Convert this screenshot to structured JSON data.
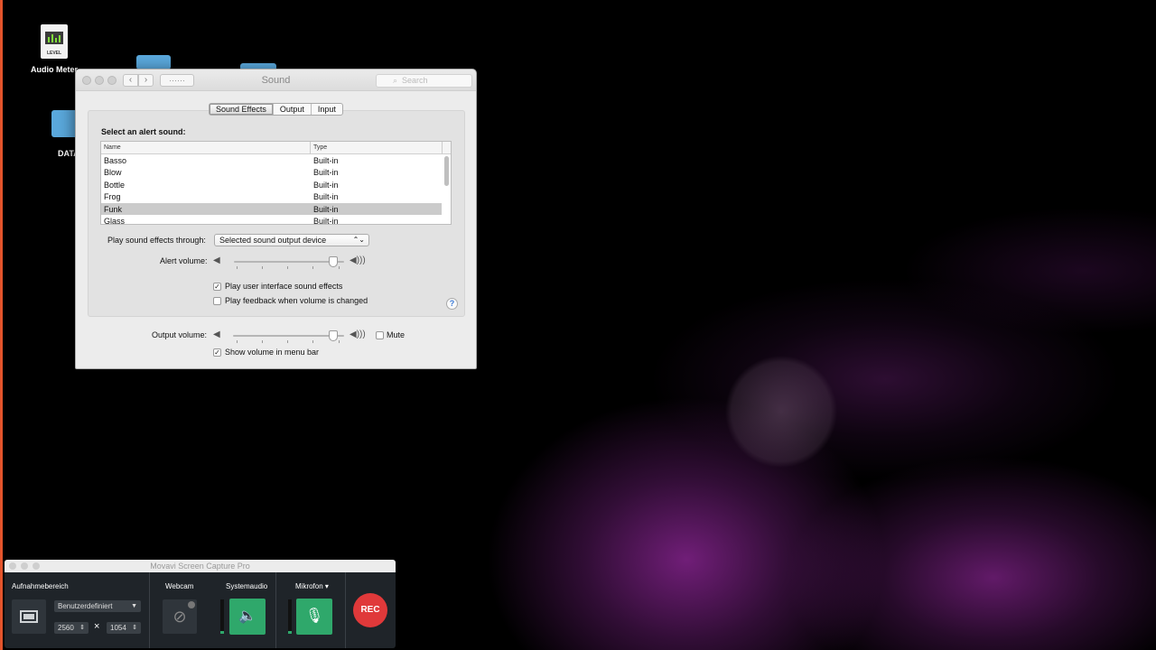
{
  "desktop": {
    "icons": [
      {
        "label": "Audio Meter"
      },
      {
        "label": "DATA"
      }
    ],
    "audio_meter_doc_text": "LEVEL"
  },
  "sound_window": {
    "title": "Sound",
    "search_placeholder": "Search",
    "nav_back_glyph": "‹",
    "nav_forward_glyph": "›",
    "grid_glyph": "⋯⋯",
    "tabs": [
      {
        "label": "Sound Effects",
        "active": true
      },
      {
        "label": "Output",
        "active": false
      },
      {
        "label": "Input",
        "active": false
      }
    ],
    "select_alert_label": "Select an alert sound:",
    "table": {
      "columns": [
        "Name",
        "Type"
      ],
      "rows": [
        {
          "name": "Basso",
          "type": "Built-in",
          "selected": false
        },
        {
          "name": "Blow",
          "type": "Built-in",
          "selected": false
        },
        {
          "name": "Bottle",
          "type": "Built-in",
          "selected": false
        },
        {
          "name": "Frog",
          "type": "Built-in",
          "selected": false
        },
        {
          "name": "Funk",
          "type": "Built-in",
          "selected": true
        },
        {
          "name": "Glass",
          "type": "Built-in",
          "selected": false
        }
      ]
    },
    "play_through_label": "Play sound effects through:",
    "play_through_value": "Selected sound output device",
    "popup_arrows": "⌃⌄",
    "alert_volume_label": "Alert volume:",
    "alert_volume_level": 0.9,
    "play_ui_sounds_label": "Play user interface sound effects",
    "play_ui_sounds_checked": true,
    "play_feedback_label": "Play feedback when volume is changed",
    "play_feedback_checked": false,
    "help_glyph": "?",
    "output_volume_label": "Output volume:",
    "output_volume_level": 0.9,
    "mute_label": "Mute",
    "mute_checked": false,
    "show_volume_label": "Show volume in menu bar",
    "show_volume_checked": true,
    "check_glyph": "✓",
    "speaker_low_glyph": "◀",
    "speaker_high_glyph": "◀)))"
  },
  "movavi": {
    "title": "Movavi Screen Capture Pro",
    "capture_area_label": "Aufnahmebereich",
    "preset_value": "Benutzerdefiniert",
    "width_value": "2560",
    "height_value": "1054",
    "times_glyph": "×",
    "stepper_glyph": "⇕",
    "dropdown_glyph": "▼",
    "webcam_label": "Webcam",
    "system_audio_label": "Systemaudio",
    "microphone_label": "Mikrofon ▾",
    "rec_label": "REC",
    "colors": {
      "rec": "#e0393a",
      "active_green": "#2fa86b"
    }
  }
}
